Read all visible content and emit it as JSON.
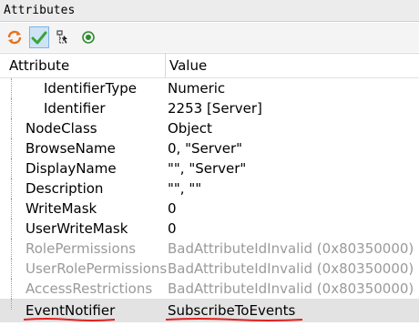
{
  "window": {
    "title": "Attributes"
  },
  "toolbar": {
    "buttons": [
      {
        "icon": "refresh-icon",
        "color": "#e8711a"
      },
      {
        "icon": "checkmark-icon",
        "color": "#3aa43a",
        "active": true
      },
      {
        "icon": "tree-hierarchy-icon",
        "color": "#555555"
      },
      {
        "icon": "subscribe-target-icon",
        "color": "#2e8b2e"
      }
    ]
  },
  "table": {
    "columns": [
      "Attribute",
      "Value"
    ],
    "rows": [
      {
        "attribute": "IdentifierType",
        "value": "Numeric",
        "level": 2,
        "dim": false
      },
      {
        "attribute": "Identifier",
        "value": "2253 [Server]",
        "level": 2,
        "dim": false
      },
      {
        "attribute": "NodeClass",
        "value": "Object",
        "level": 1,
        "dim": false
      },
      {
        "attribute": "BrowseName",
        "value": "0, \"Server\"",
        "level": 1,
        "dim": false
      },
      {
        "attribute": "DisplayName",
        "value": "\"\", \"Server\"",
        "level": 1,
        "dim": false
      },
      {
        "attribute": "Description",
        "value": "\"\", \"\"",
        "level": 1,
        "dim": false
      },
      {
        "attribute": "WriteMask",
        "value": "0",
        "level": 1,
        "dim": false
      },
      {
        "attribute": "UserWriteMask",
        "value": "0",
        "level": 1,
        "dim": false
      },
      {
        "attribute": "RolePermissions",
        "value": "BadAttributeIdInvalid (0x80350000)",
        "level": 1,
        "dim": true
      },
      {
        "attribute": "UserRolePermissions",
        "value": "BadAttributeIdInvalid (0x80350000)",
        "level": 1,
        "dim": true
      },
      {
        "attribute": "AccessRestrictions",
        "value": "BadAttributeIdInvalid (0x80350000)",
        "level": 1,
        "dim": true
      },
      {
        "attribute": "EventNotifier",
        "value": "SubscribeToEvents",
        "level": 1,
        "dim": false,
        "selected": true,
        "annotated": true
      }
    ]
  },
  "colors": {
    "selection": "#e3e3e3",
    "annotation": "#e02020",
    "dim_text": "#9a9a9a"
  }
}
